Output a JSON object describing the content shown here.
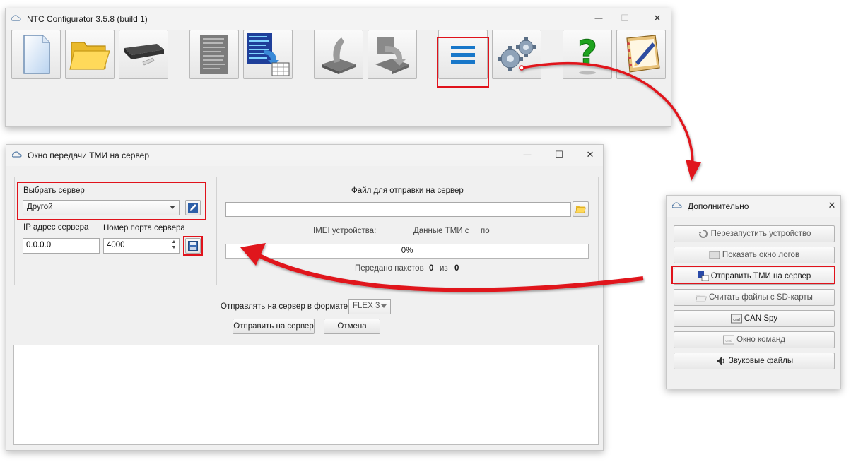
{
  "main_window": {
    "title": "NTC Configurator 3.5.8 (build 1)",
    "controls": {
      "minimize": "—",
      "maximize": "☐",
      "close": "✕"
    },
    "toolbar": [
      {
        "name": "new-file-button",
        "icon": "document-icon"
      },
      {
        "name": "open-folder-button",
        "icon": "folder-icon"
      },
      {
        "name": "device-button",
        "icon": "device-icon"
      },
      {
        "name": "raw-data-button",
        "icon": "binary-data-icon"
      },
      {
        "name": "export-data-button",
        "icon": "data-export-icon"
      },
      {
        "name": "read-config-button",
        "icon": "lever-up-icon"
      },
      {
        "name": "write-config-button",
        "icon": "lever-down-icon"
      },
      {
        "name": "menu-button",
        "icon": "hamburger-menu-icon"
      },
      {
        "name": "settings-button",
        "icon": "gears-icon"
      },
      {
        "name": "help-button",
        "icon": "question-icon"
      },
      {
        "name": "about-button",
        "icon": "notebook-icon"
      }
    ]
  },
  "tmi_window": {
    "title": "Окно передачи ТМИ на сервер",
    "controls": {
      "minimize": "—",
      "maximize": "☐",
      "close": "✕"
    },
    "server": {
      "select_label": "Выбрать сервер",
      "selected": "Другой",
      "ip_label": "IP адрес сервера",
      "ip_value": "0.0.0.0",
      "port_label": "Номер порта сервера",
      "port_value": "4000"
    },
    "file": {
      "label": "Файл для отправки на сервер",
      "path_value": "",
      "imei_label": "IMEI устройства:",
      "tmi_data_label": "Данные ТМИ с",
      "to_label": "по",
      "progress_text": "0%",
      "progress_value": 0,
      "packets_label": "Передано пакетов",
      "packets_sent": "0",
      "of_label": "из",
      "packets_total": "0"
    },
    "format_label": "Отправлять на сервер в формате:",
    "format_value": "FLEX 3",
    "send_button": "Отправить на сервер",
    "cancel_button": "Отмена",
    "log_text": ""
  },
  "extra_window": {
    "title": "Дополнительно",
    "close": "✕",
    "items": [
      {
        "label": "Перезапустить устройство",
        "icon": "restart-icon"
      },
      {
        "label": "Показать окно логов",
        "icon": "log-window-icon"
      },
      {
        "label": "Отправить ТМИ на сервер",
        "icon": "send-tmi-icon"
      },
      {
        "label": "Считать файлы с SD-карты",
        "icon": "sd-folder-icon"
      },
      {
        "label": "CAN Spy",
        "icon": "cmd-icon"
      },
      {
        "label": "Окно команд",
        "icon": "cmd-icon"
      },
      {
        "label": "Звуковые файлы",
        "icon": "sound-icon"
      }
    ]
  },
  "colors": {
    "highlight": "#e0121b",
    "menu_icon": "#1877c9",
    "window_bg": "#f0f0f0"
  }
}
